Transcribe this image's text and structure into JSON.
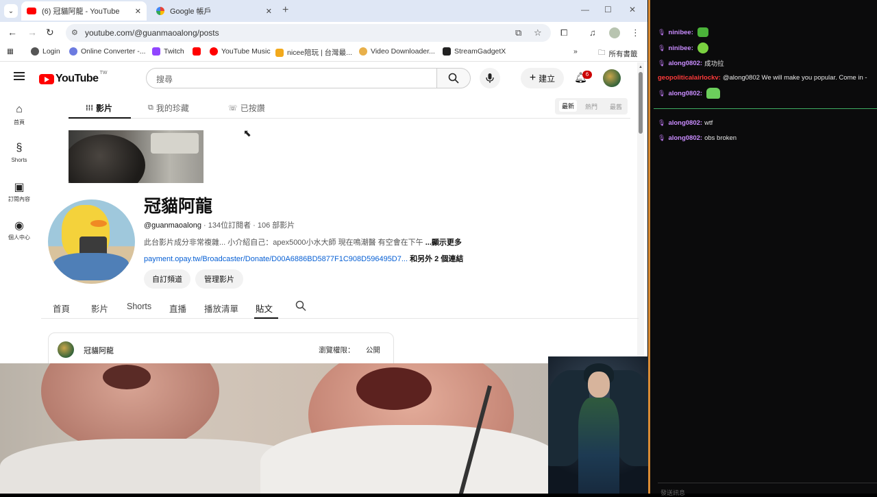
{
  "browser": {
    "tabs": [
      {
        "title": "(6) 冠貓阿龍 - YouTube",
        "active": true
      },
      {
        "title": "Google 帳戶",
        "active": false
      }
    ],
    "url": "youtube.com/@guanmaoalong/posts",
    "bookmarks": [
      "Login",
      "Online Converter -...",
      "Twitch",
      "YouTube Music",
      "nicee陪玩 | 台灣最...",
      "Video Downloader...",
      "StreamGadgetX",
      "所有書籤"
    ]
  },
  "youtube": {
    "logo_word": "YouTube",
    "logo_region": "TW",
    "search_placeholder": "搜尋",
    "create_label": "建立",
    "notification_count": "6",
    "sidebar": [
      {
        "label": "首頁",
        "icon": "home-icon"
      },
      {
        "label": "Shorts",
        "icon": "shorts-icon"
      },
      {
        "label": "訂閱內容",
        "icon": "subscriptions-icon"
      },
      {
        "label": "個人中心",
        "icon": "profile-icon"
      }
    ],
    "post_tabs": [
      "影片",
      "我的珍藏",
      "已按讚"
    ],
    "sort_options": [
      "最新",
      "熱門",
      "最舊"
    ],
    "channel": {
      "name": "冠貓阿龍",
      "handle": "@guanmaoalong",
      "meta": " · 134位訂閱者 · 106 部影片",
      "description": "此台影片成分非常複雜... 小介紹自己：apex5000小水大師 現在鳴潮醫  有空會在下午",
      "more": "...顯示更多",
      "link": "payment.opay.tw/Broadcaster/Donate/D00A6886BD5877F1C908D596495D7...",
      "link_extra": "和另外 2 個連結",
      "buttons": [
        "自訂頻道",
        "管理影片"
      ]
    },
    "channel_tabs": [
      "首頁",
      "影片",
      "Shorts",
      "直播",
      "播放清單",
      "貼文"
    ],
    "active_channel_tab": "貼文",
    "post": {
      "author": "冠貓阿龍",
      "visibility_label": "瀏覽權限：",
      "visibility_value": "公開"
    }
  },
  "chat": {
    "messages": [
      {
        "user": "ninibee:",
        "text": "",
        "emote": "emote"
      },
      {
        "user": "ninibee:",
        "text": "",
        "emote": "blob"
      },
      {
        "user": "along0802:",
        "text": "成功拉",
        "emote": ""
      },
      {
        "user": "geopoliticalairlockv:",
        "text": "@along0802 We will make you popular. Come in - ",
        "emote": "",
        "highlight": true
      },
      {
        "user": "along0802:",
        "text": "",
        "emote": "bot"
      },
      {
        "user": "along0802:",
        "text": "wtf",
        "emote": ""
      },
      {
        "user": "along0802:",
        "text": "obs broken",
        "emote": ""
      }
    ],
    "input_placeholder": "發送訊息"
  },
  "colors": {
    "youtube_red": "#ff0000",
    "chat_user": "#c98cff",
    "chat_highlight_user": "#ff3a3a",
    "chat_divider": "#3fae64",
    "link_blue": "#065fd4"
  }
}
